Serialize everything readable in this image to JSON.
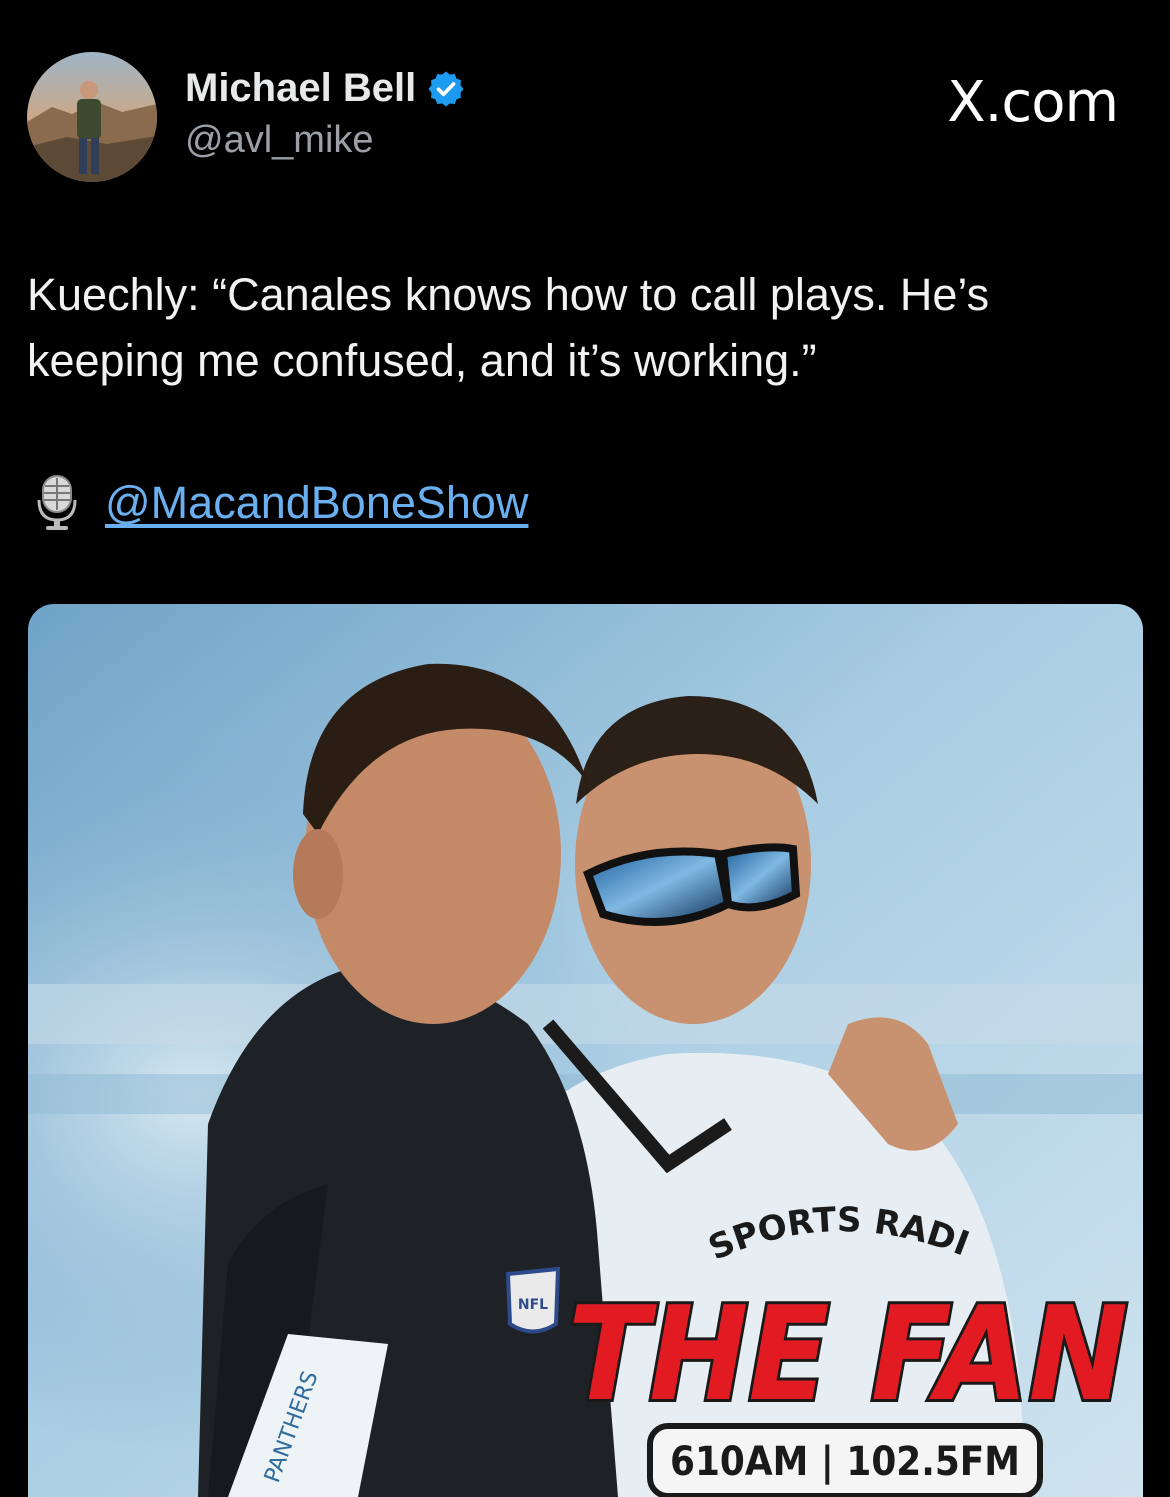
{
  "author": {
    "name": "Michael Bell",
    "handle": "@avl_mike",
    "verified": true
  },
  "site_brand": "X.com",
  "tweet": {
    "text": "Kuechly: “Canales knows how to call plays. He’s keeping me confused, and it’s working.”",
    "mention_icon": "microphone-icon",
    "mention": "@MacandBoneShow"
  },
  "media": {
    "logo": {
      "arc_text": "SPORTS RADIO",
      "title": "THE FAN",
      "frequencies": "610AM | 102.5FM"
    },
    "shirt_lettering": "PANTHERS",
    "badge_lettering": "NFL"
  },
  "colors": {
    "background": "#000000",
    "link": "#6ab0f0",
    "verified_badge": "#1d9bf0",
    "logo_red": "#e21b22"
  }
}
